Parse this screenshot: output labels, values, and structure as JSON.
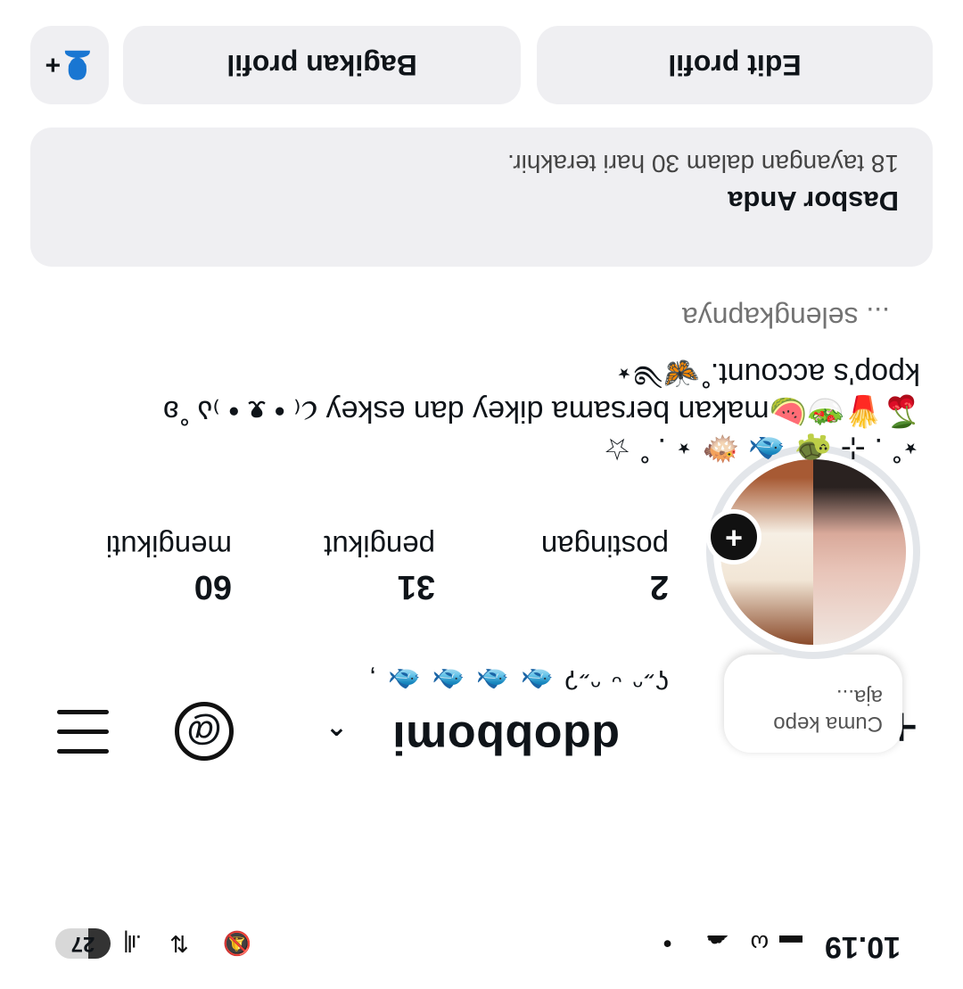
{
  "status_bar": {
    "time": "10.19",
    "battery": "27",
    "notification_icons": [
      "square-icon",
      "whatsapp-icon",
      "cloud-icon",
      "dot-icon"
    ]
  },
  "top_bar": {
    "username": "ddobbomi",
    "chevron": "^",
    "add_icon": "plus-icon",
    "threads_icon": "threads-icon",
    "menu_icon": "hamburger-icon"
  },
  "profile": {
    "note": "Cuma kepo aja...",
    "decor_line": "ʕ˶ᵔ ᵕ ᵔ˶ʔ 🐟 🐟 🐟 🐟 ,",
    "stats": [
      {
        "value": "2",
        "label": "postingan"
      },
      {
        "value": "31",
        "label": "pengikut"
      },
      {
        "value": "60",
        "label": "mengikuti"
      }
    ]
  },
  "bio": {
    "line1": "⋆˚ . ⊹ 🐢 🐟 🐡 ⋆ . ˚ ☆",
    "line2": "🍒🍟🥗🍉makan bersama dikey dan eskey ૮₍ • ᴥ • ₎ა ˚ʚ",
    "line3": "kpop's account.˚🦋༄⋆",
    "more": "... selengkapnya"
  },
  "dashboard": {
    "title": "Dasbor Anda",
    "subtitle": "18 tayangan dalam 30 hari terakhir."
  },
  "buttons": {
    "edit": "Edit profil",
    "share": "Bagikan profil",
    "add_user_icon": "add-user-icon"
  }
}
